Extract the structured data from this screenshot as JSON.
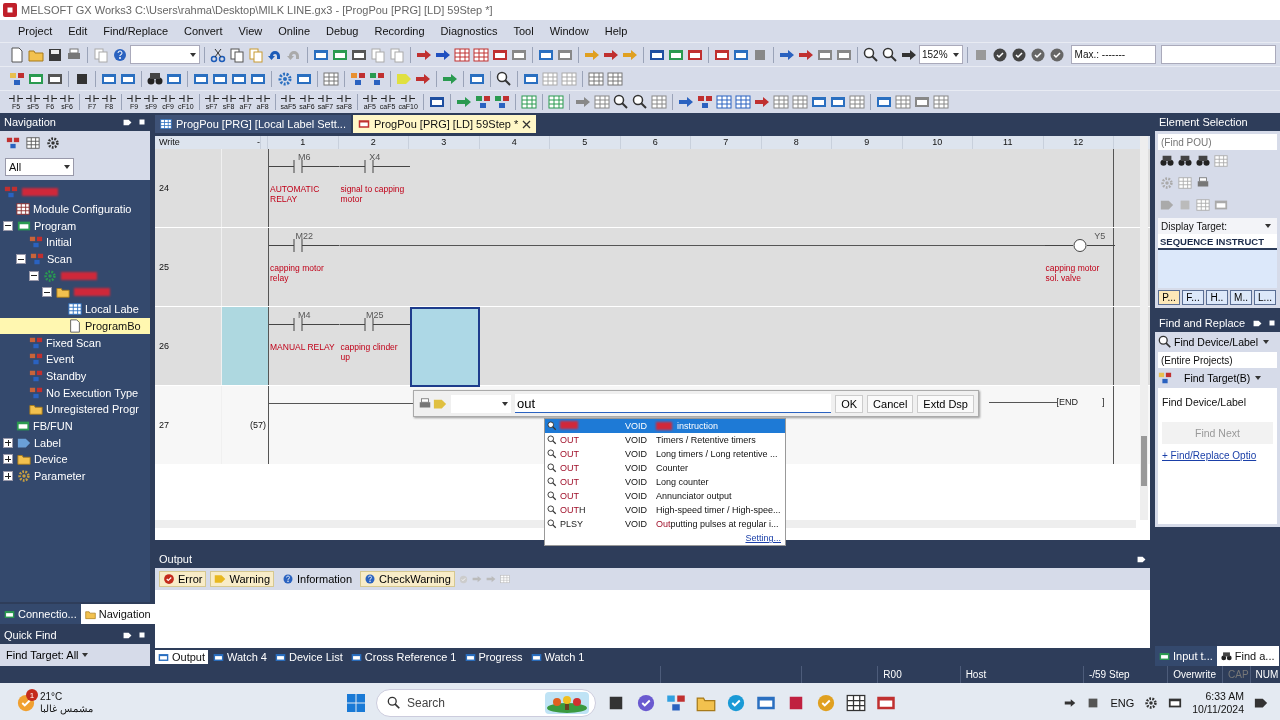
{
  "window": {
    "title": "MELSOFT GX Works3 C:\\Users\\rahma\\Desktop\\MILK LINE.gx3 - [ProgPou [PRG] [LD] 59Step *]"
  },
  "menu": [
    "Project",
    "Edit",
    "Find/Replace",
    "Convert",
    "View",
    "Online",
    "Debug",
    "Recording",
    "Diagnostics",
    "Tool",
    "Window",
    "Help"
  ],
  "toolbar": {
    "zoom": "152%",
    "max_label": "Max.: -------"
  },
  "function_keys": [
    "F5",
    "sF5",
    "F6",
    "sF6",
    "F7",
    "F8",
    "F9",
    "sF9",
    "cF9",
    "cF10",
    "sF7",
    "sF8",
    "aF7",
    "aF8",
    "saF5",
    "saF6",
    "saF7",
    "saF8",
    "aF5",
    "caF5",
    "caF10"
  ],
  "navigation": {
    "title": "Navigation",
    "filter": "All",
    "tree": [
      {
        "kind": "project",
        "redacted": true,
        "selected": false,
        "children": [
          {
            "kind": "module",
            "label": "Module Configuratio",
            "selected": false
          },
          {
            "kind": "program",
            "label": "Program",
            "expanded": true,
            "selected": false,
            "children": [
              {
                "kind": "task",
                "label": "Initial",
                "selected": false
              },
              {
                "kind": "task",
                "label": "Scan",
                "expanded": true,
                "selected": false,
                "children": [
                  {
                    "kind": "program-file",
                    "redacted": true,
                    "expanded": true,
                    "selected": false,
                    "children": [
                      {
                        "kind": "pou",
                        "redacted": true,
                        "expanded": true,
                        "selected": false,
                        "children": [
                          {
                            "kind": "local-label",
                            "label": "Local Labe",
                            "selected": false
                          },
                          {
                            "kind": "body",
                            "label": "ProgramBo",
                            "selected": true
                          }
                        ]
                      }
                    ]
                  }
                ]
              },
              {
                "kind": "task",
                "label": "Fixed Scan",
                "selected": false
              },
              {
                "kind": "task",
                "label": "Event",
                "selected": false
              },
              {
                "kind": "task",
                "label": "Standby",
                "selected": false
              },
              {
                "kind": "task",
                "label": "No Execution Type",
                "selected": false
              },
              {
                "kind": "folder",
                "label": "Unregistered Progr",
                "selected": false
              }
            ]
          },
          {
            "kind": "fbfun",
            "label": "FB/FUN",
            "selected": false
          },
          {
            "kind": "label",
            "label": "Label",
            "expanded": false,
            "selected": false
          },
          {
            "kind": "device",
            "label": "Device",
            "expanded": false,
            "selected": false
          },
          {
            "kind": "parameter",
            "label": "Parameter",
            "expanded": false,
            "selected": false
          }
        ]
      }
    ]
  },
  "left_tabs": [
    {
      "label": "Connectio...",
      "selected": false
    },
    {
      "label": "Navigation",
      "selected": true
    }
  ],
  "quick_find": {
    "title": "Quick Find",
    "target": "Find Target: All"
  },
  "editor_tabs": [
    {
      "label": "ProgPou [PRG] [Local Label Sett...",
      "selected": false
    },
    {
      "label": "ProgPou [PRG] [LD] 59Step *",
      "selected": true
    }
  ],
  "ladder": {
    "mode": "Write",
    "mode_marker": "-",
    "columns": [
      "1",
      "2",
      "3",
      "4",
      "5",
      "6",
      "7",
      "8",
      "9",
      "10",
      "11",
      "12"
    ],
    "rows": [
      {
        "number": "24",
        "unconverted": true,
        "selected": false,
        "elements": [
          {
            "kind": "contact",
            "device": "M6",
            "comment": "AUTOMATIC RELAY"
          },
          {
            "kind": "contact",
            "device": "X4",
            "comment": "signal to capping motor"
          }
        ]
      },
      {
        "number": "25",
        "unconverted": true,
        "selected": false,
        "elements": [
          {
            "kind": "contact",
            "device": "M22",
            "comment": "capping motor relay"
          },
          {
            "kind": "coil",
            "device": "Y5",
            "comment": "capping motor sol. valve"
          }
        ]
      },
      {
        "number": "26",
        "unconverted": true,
        "selected": true,
        "elements": [
          {
            "kind": "contact",
            "device": "M4",
            "comment": "MANUAL RELAY"
          },
          {
            "kind": "contact",
            "device": "M25",
            "comment": "capping clinder up"
          },
          {
            "kind": "cursor"
          }
        ]
      },
      {
        "number": "27",
        "step": "(57)",
        "unconverted": false,
        "selected": false,
        "elements": [
          {
            "kind": "end",
            "label": "[END",
            "bracket": "]"
          }
        ]
      }
    ]
  },
  "instruction_input": {
    "value": "out",
    "buttons": [
      "OK",
      "Cancel",
      "Extd Dsp"
    ],
    "suggestions": [
      {
        "type": "VOID",
        "description": "instruction",
        "redacted": true,
        "selected": true
      },
      {
        "name": "**OUT**",
        "type": "VOID",
        "description": "Timers / Retentive timers",
        "redacted": false,
        "selected": false
      },
      {
        "name": "**OUT**",
        "type": "VOID",
        "description": "Long timers / Long retentive ...",
        "redacted": false,
        "selected": false
      },
      {
        "name": "**OUT**",
        "type": "VOID",
        "description": "Counter",
        "redacted": false,
        "selected": false
      },
      {
        "name": "**OUT**",
        "type": "VOID",
        "description": "Long counter",
        "redacted": false,
        "selected": false
      },
      {
        "name": "**OUT**",
        "type": "VOID",
        "description": "Annunciator output",
        "redacted": false,
        "selected": false
      },
      {
        "name": "**OUT**H",
        "type": "VOID",
        "description": "High-speed timer / High-spee...",
        "redacted": false,
        "selected": false
      },
      {
        "name": "PLSY",
        "type": "VOID",
        "description": "**Out**putting pulses at regular i...",
        "redacted": false,
        "selected": false
      }
    ],
    "link": "Setting..."
  },
  "output": {
    "title": "Output",
    "filters": [
      {
        "kind": "error",
        "label": "Error",
        "on": true
      },
      {
        "kind": "warning",
        "label": "Warning",
        "on": true
      },
      {
        "kind": "information",
        "label": "Information",
        "on": false
      },
      {
        "kind": "checkwarning",
        "label": "CheckWarning",
        "on": true
      }
    ],
    "tabs": [
      {
        "label": "Output",
        "selected": true
      },
      {
        "label": "Watch 4",
        "selected": false
      },
      {
        "label": "Device List",
        "selected": false
      },
      {
        "label": "Cross Reference 1",
        "selected": false
      },
      {
        "label": "Progress",
        "selected": false
      },
      {
        "label": "Watch 1",
        "selected": false
      }
    ]
  },
  "element_selection": {
    "title": "Element Selection",
    "placeholder": "(Find POU)",
    "display_target": "Display Target:",
    "list_header": "SEQUENCE INSTRUCT",
    "tabs": [
      {
        "label": "P...",
        "selected": true
      },
      {
        "label": "F...",
        "selected": false
      },
      {
        "label": "H..",
        "selected": false
      },
      {
        "label": "M..",
        "selected": false
      },
      {
        "label": "L...",
        "selected": false
      }
    ]
  },
  "find_replace": {
    "title": "Find and Replace",
    "mode": "Find Device/Label",
    "scope": "(Entire Projects)",
    "target": "Find Target(B)",
    "heading": "Find Device/Label",
    "find_next": "Find Next",
    "find_next_disabled": true,
    "options_link": "+ Find/Replace Optio"
  },
  "right_tabs": [
    {
      "label": "Input t...",
      "selected": false
    },
    {
      "label": "Find a...",
      "selected": true
    }
  ],
  "status_bar": [
    {
      "text": "R00",
      "disabled": false
    },
    {
      "text": "Host",
      "disabled": false
    },
    {
      "text": "-/59 Step",
      "disabled": false
    },
    {
      "text": "Overwrite",
      "disabled": false
    },
    {
      "text": "CAP",
      "disabled": true
    },
    {
      "text": "NUM",
      "disabled": false
    }
  ],
  "taskbar": {
    "badge": "1",
    "temperature": "21°C",
    "condition": "مشمس غالبا",
    "search": "Search",
    "language": "ENG",
    "time": "6:33 AM",
    "date": "10/11/2024"
  }
}
